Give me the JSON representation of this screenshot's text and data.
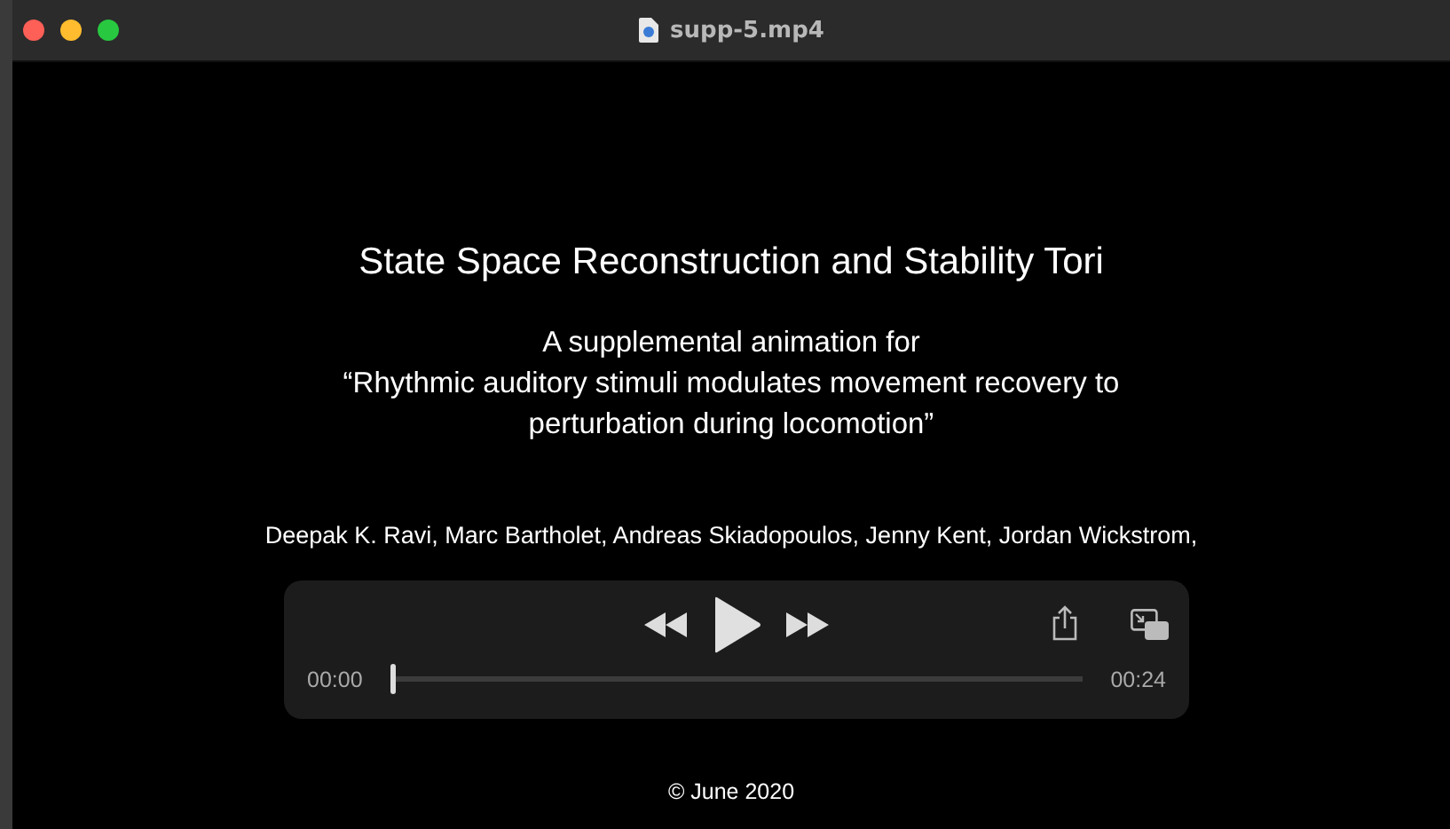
{
  "window": {
    "title": "supp-5.mp4"
  },
  "slide": {
    "title": "State Space Reconstruction and Stability Tori",
    "subtitle_lines": [
      "A supplemental animation for",
      "“Rhythmic auditory stimuli modulates movement recovery to",
      "perturbation during locomotion”"
    ],
    "authors": "Deepak K. Ravi, Marc Bartholet, Andreas Skiadopoulos, Jenny Kent, Jordan Wickstrom,",
    "footer": "© June 2020"
  },
  "controls": {
    "elapsed": "00:00",
    "duration": "00:24",
    "level": 0
  }
}
